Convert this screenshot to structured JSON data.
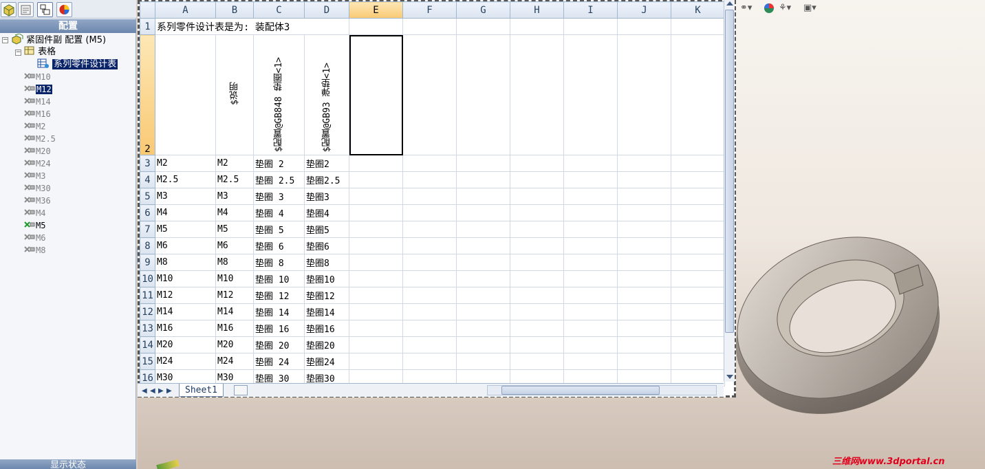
{
  "left_panel": {
    "tabs": [
      "feature-manager-tab",
      "property-manager-tab",
      "configuration-manager-tab",
      "display-manager-tab"
    ],
    "header": "配置",
    "root": {
      "label": "紧固件副  配置  (M5)"
    },
    "tables_node": {
      "label": "表格"
    },
    "design_table": {
      "label": "系列零件设计表"
    },
    "configurations": [
      "M10",
      "M12",
      "M14",
      "M16",
      "M2",
      "M2.5",
      "M20",
      "M24",
      "M3",
      "M30",
      "M36",
      "M4",
      "M5",
      "M6",
      "M8"
    ],
    "selected_config": "M12",
    "active_config": "M5",
    "bottom_header": "显示状态"
  },
  "spreadsheet": {
    "columns": [
      "A",
      "B",
      "C",
      "D",
      "E",
      "F",
      "G",
      "H",
      "I",
      "J",
      "K"
    ],
    "selected_column": "E",
    "row1_title": "系列零件设计表是为:   装配体3",
    "row2_headers": [
      "$说明",
      "$配置@GB848 垫圈<1>",
      "$配置@GB93 弹垫<1>"
    ],
    "rows": [
      {
        "n": "3",
        "a": "M2",
        "b": "M2",
        "c": "垫圈 2",
        "d": "垫圈2"
      },
      {
        "n": "4",
        "a": "M2.5",
        "b": "M2.5",
        "c": "垫圈 2.5",
        "d": "垫圈2.5"
      },
      {
        "n": "5",
        "a": "M3",
        "b": "M3",
        "c": "垫圈 3",
        "d": "垫圈3"
      },
      {
        "n": "6",
        "a": "M4",
        "b": "M4",
        "c": "垫圈 4",
        "d": "垫圈4"
      },
      {
        "n": "7",
        "a": "M5",
        "b": "M5",
        "c": "垫圈 5",
        "d": "垫圈5"
      },
      {
        "n": "8",
        "a": "M6",
        "b": "M6",
        "c": "垫圈 6",
        "d": "垫圈6"
      },
      {
        "n": "9",
        "a": "M8",
        "b": "M8",
        "c": "垫圈 8",
        "d": "垫圈8"
      },
      {
        "n": "10",
        "a": "M10",
        "b": "M10",
        "c": "垫圈 10",
        "d": "垫圈10"
      },
      {
        "n": "11",
        "a": "M12",
        "b": "M12",
        "c": "垫圈 12",
        "d": "垫圈12"
      },
      {
        "n": "12",
        "a": "M14",
        "b": "M14",
        "c": "垫圈 14",
        "d": "垫圈14"
      },
      {
        "n": "13",
        "a": "M16",
        "b": "M16",
        "c": "垫圈 16",
        "d": "垫圈16"
      },
      {
        "n": "14",
        "a": "M20",
        "b": "M20",
        "c": "垫圈 20",
        "d": "垫圈20"
      },
      {
        "n": "15",
        "a": "M24",
        "b": "M24",
        "c": "垫圈 24",
        "d": "垫圈24"
      },
      {
        "n": "16",
        "a": "M30",
        "b": "M30",
        "c": "垫圈 30",
        "d": "垫圈30"
      }
    ],
    "sheet_tab": "Sheet1"
  },
  "watermark": "三维网www.3dportal.cn",
  "colors": {
    "selection": "#0a246a",
    "header_selected": "#f9c974",
    "watermark": "#e0001b"
  }
}
